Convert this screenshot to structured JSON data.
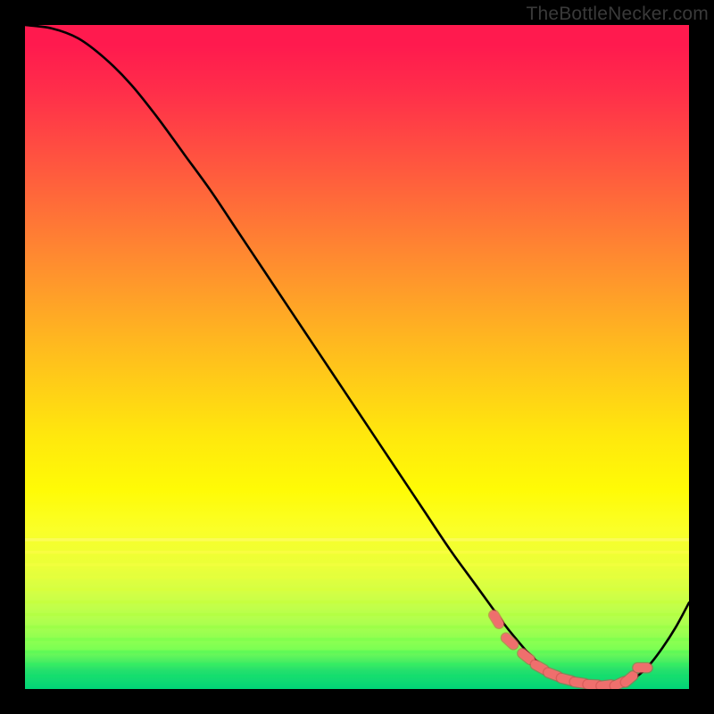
{
  "attribution": "TheBottleNecker.com",
  "colors": {
    "frame": "#000000",
    "curve": "#000000",
    "dot_fill": "#ef6f6d",
    "dot_stroke": "#c94f4d"
  },
  "chart_data": {
    "type": "line",
    "title": "",
    "xlabel": "",
    "ylabel": "",
    "xlim": [
      0,
      100
    ],
    "ylim": [
      0,
      100
    ],
    "series": [
      {
        "name": "bottleneck-curve",
        "x": [
          0,
          4,
          8,
          12,
          16,
          20,
          24,
          28,
          32,
          36,
          40,
          44,
          48,
          52,
          56,
          60,
          64,
          68,
          72,
          74,
          76,
          78,
          80,
          82,
          84,
          86,
          88,
          90,
          92,
          94,
          96,
          98,
          100
        ],
        "y": [
          100,
          99.5,
          98,
          95,
          91,
          86,
          80.5,
          75,
          69,
          63,
          57,
          51,
          45,
          39,
          33,
          27,
          21,
          15.5,
          10,
          7.5,
          5.2,
          3.4,
          2.1,
          1.25,
          0.75,
          0.5,
          0.5,
          0.9,
          1.8,
          3.6,
          6.2,
          9.3,
          13
        ]
      }
    ],
    "markers": {
      "name": "optimal-range-dots",
      "style": "round-caps",
      "x": [
        71,
        73,
        75.5,
        77.5,
        79.5,
        81.5,
        83.5,
        85.5,
        87.5,
        89.5,
        91,
        93
      ],
      "y": [
        10.5,
        7.2,
        4.9,
        3.3,
        2.2,
        1.45,
        0.95,
        0.65,
        0.55,
        0.8,
        1.5,
        3.2
      ]
    }
  }
}
